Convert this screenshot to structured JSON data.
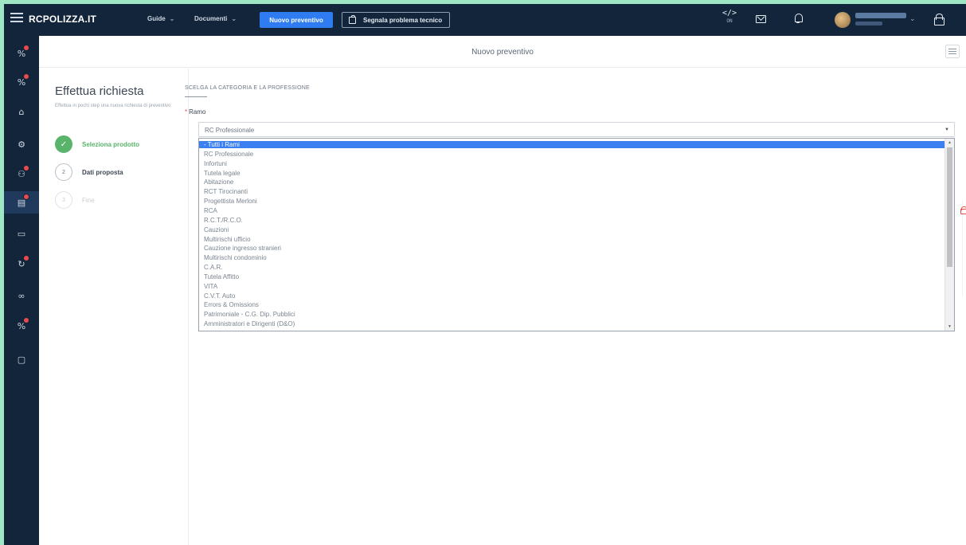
{
  "app": {
    "brand": "RCPOLIZZA.IT",
    "nav": [
      {
        "label": "Guide"
      },
      {
        "label": "Documenti"
      }
    ],
    "new_quote_label": "Nuovo preventivo",
    "report_issue_label": "Segnala problema tecnico",
    "dev_mode": {
      "icon": "</>",
      "status": "ON"
    },
    "icons": [
      "hamburger-icon",
      "mail-icon",
      "bell-icon",
      "avatar",
      "lock-icon"
    ],
    "colors": {
      "topbar": "#12253a",
      "primary": "#2f7bf2",
      "success": "#59b36a",
      "badge": "#e84b4b",
      "highlight": "#3b7ff0"
    }
  },
  "sidebar": {
    "items": [
      {
        "icon": "percent-icon",
        "badge": true
      },
      {
        "icon": "percent-icon",
        "badge": true
      },
      {
        "icon": "home-icon",
        "badge": false
      },
      {
        "icon": "settings-icon",
        "badge": false
      },
      {
        "icon": "users-icon",
        "badge": true
      },
      {
        "icon": "documents-icon",
        "badge": true,
        "active": true
      },
      {
        "icon": "briefcase-icon",
        "badge": false
      },
      {
        "icon": "refresh-icon",
        "badge": true
      },
      {
        "icon": "link-icon",
        "badge": false
      },
      {
        "icon": "percent-icon",
        "badge": true
      },
      {
        "icon": "chat-icon",
        "badge": false
      }
    ]
  },
  "header": {
    "title": "Nuovo preventivo"
  },
  "steps": {
    "title": "Effettua richiesta",
    "description": "Effettua in pochi step una nuova richiesta di preventivo",
    "items": [
      {
        "number": "✓",
        "label": "Seleziona prodotto",
        "state": "done"
      },
      {
        "number": "2",
        "label": "Dati proposta",
        "state": "current"
      },
      {
        "number": "3",
        "label": "Fine",
        "state": "disabled"
      }
    ]
  },
  "form": {
    "section_heading": "SCELGA LA CATEGORIA E LA PROFESSIONE",
    "ramo_label": "Ramo",
    "required_mark": "*",
    "ramo_value": "RC Professionale",
    "ramo_options": [
      "- Tutti i Rami",
      "RC Professionale",
      "Infortuni",
      "Tutela legale",
      "Abitazione",
      "RCT Tirocinanti",
      "Progettista Merloni",
      "RCA",
      "R.C.T./R.C.O.",
      "Cauzioni",
      "Multirischi ufficio",
      "Cauzione ingresso stranieri",
      "Multirischi condominio",
      "C.A.R.",
      "Tutela Affitto",
      "VITA",
      "C.V.T. Auto",
      "Errors & Omissions",
      "Patrimoniale - C.G. Dip. Pubblici",
      "Amministratori e Dirigenti (D&O)"
    ],
    "highlighted_index": 0
  }
}
